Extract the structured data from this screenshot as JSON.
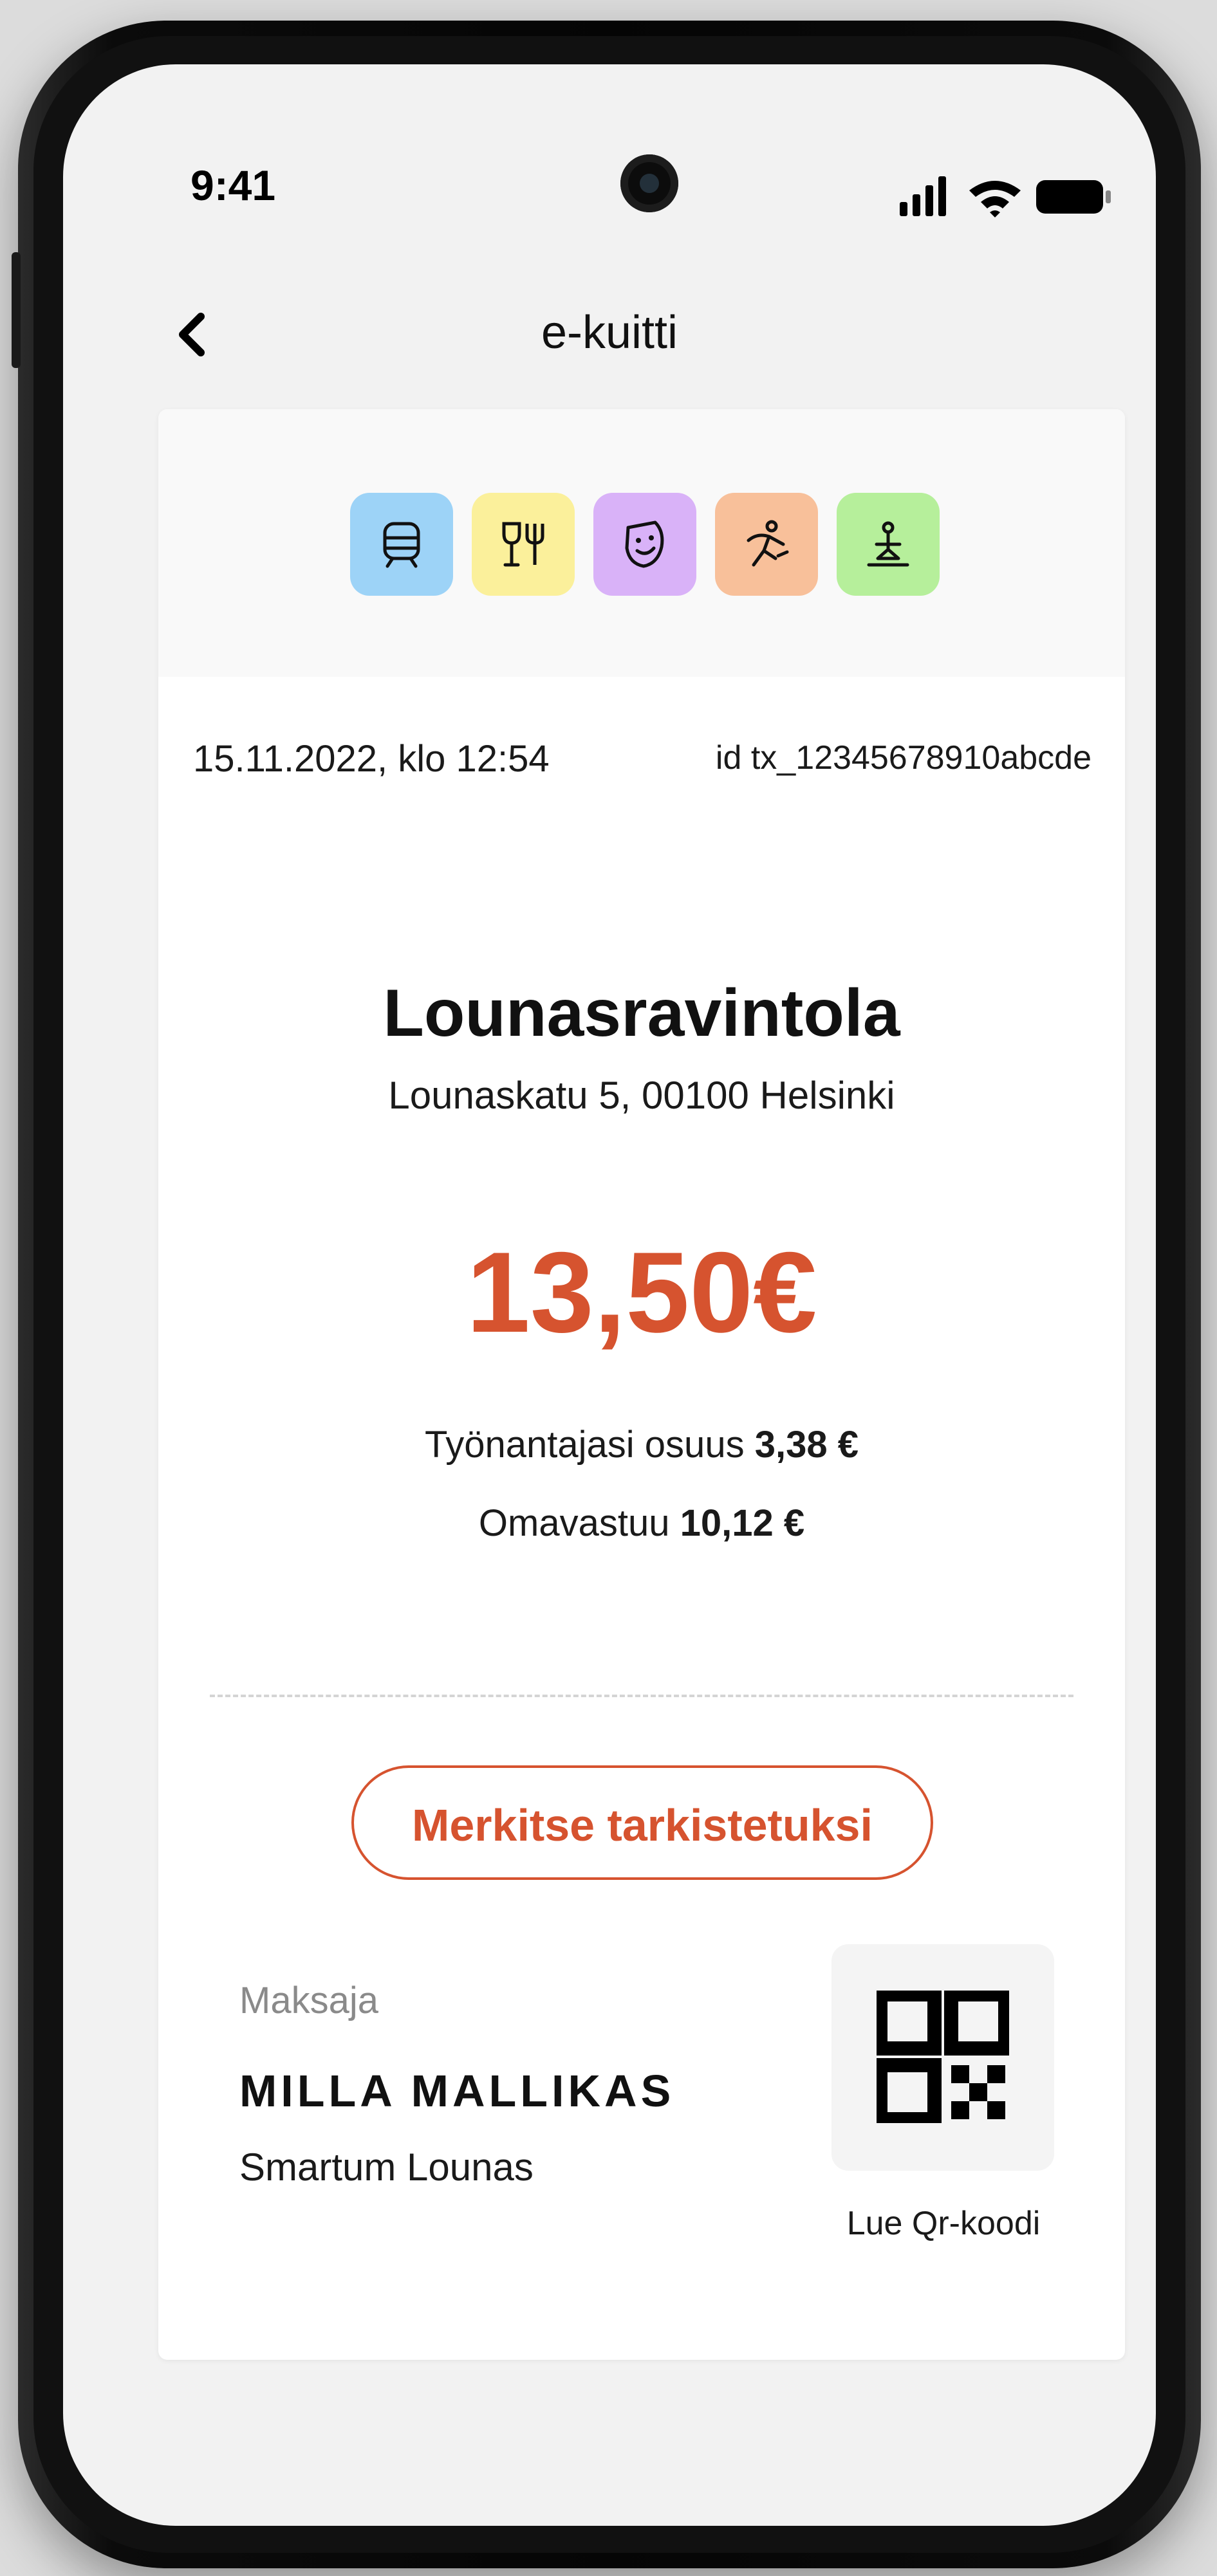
{
  "status_bar": {
    "time": "9:41"
  },
  "header": {
    "title": "e-kuitti"
  },
  "categories": [
    {
      "name": "transport",
      "color": "#9dd3f7",
      "icon": "train-icon"
    },
    {
      "name": "food",
      "color": "#fbf09b",
      "icon": "restaurant-icon"
    },
    {
      "name": "culture",
      "color": "#d9b2f8",
      "icon": "theater-mask-icon"
    },
    {
      "name": "sports",
      "color": "#f8c09a",
      "icon": "running-icon"
    },
    {
      "name": "wellbeing",
      "color": "#b6ef9b",
      "icon": "wellness-icon"
    }
  ],
  "receipt": {
    "date": "15.11.2022, klo 12:54",
    "id": "id tx_12345678910abcde",
    "merchant": "Lounasravintola",
    "address": "Lounaskatu 5, 00100 Helsinki",
    "amount": "13,50€",
    "employer_share_label": "Työnantajasi osuus",
    "employer_share_value": "3,38 €",
    "own_share_label": "Omavastuu",
    "own_share_value": "10,12 €",
    "accent_color": "#d6532f"
  },
  "actions": {
    "mark_checked": "Merkitse tarkistetuksi"
  },
  "payer": {
    "label": "Maksaja",
    "name": "MILLA MALLIKAS",
    "benefit": "Smartum Lounas"
  },
  "qr": {
    "label": "Lue Qr-koodi"
  }
}
